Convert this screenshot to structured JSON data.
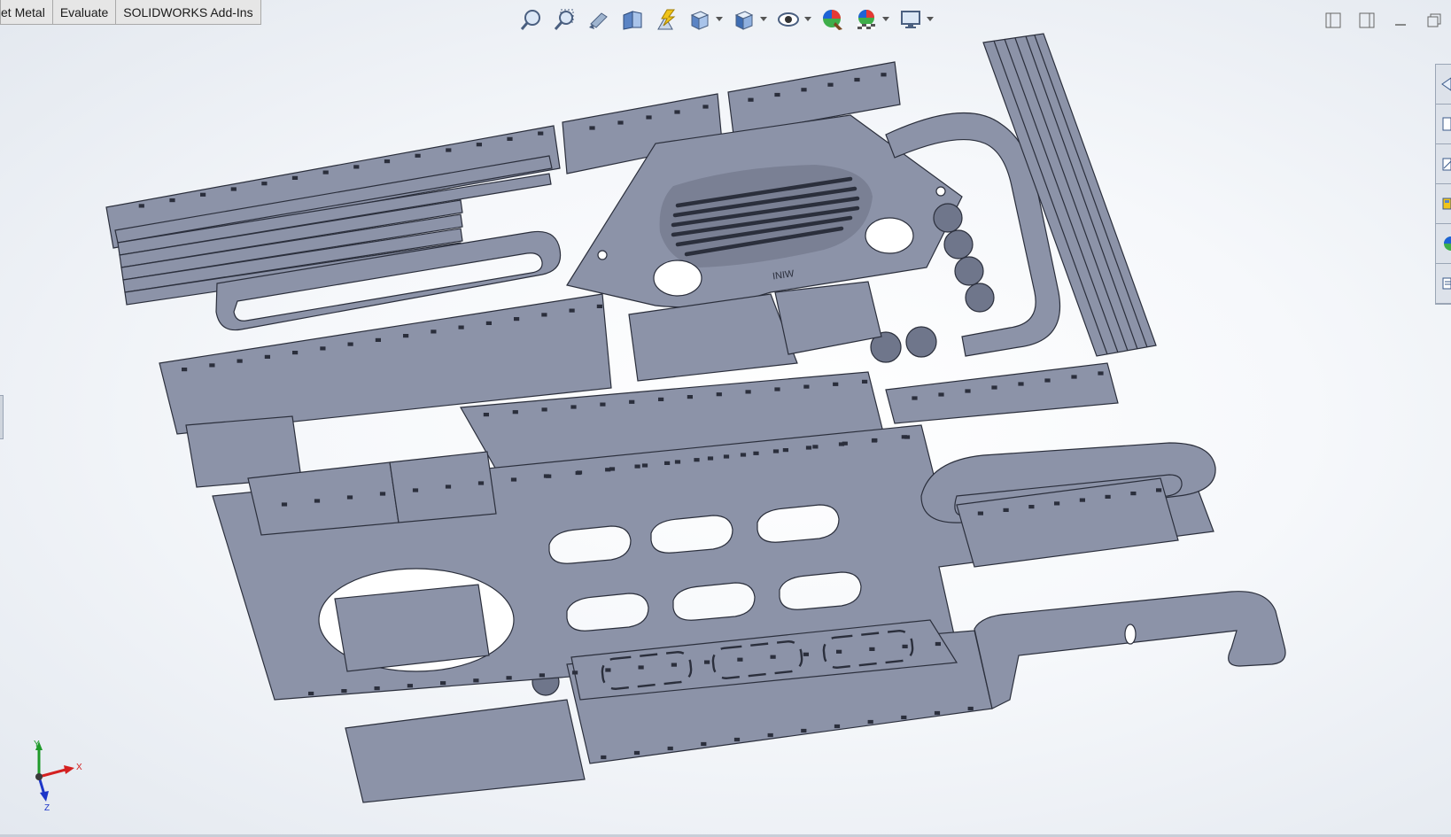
{
  "command_tabs": [
    {
      "label": "et Metal"
    },
    {
      "label": "Evaluate"
    },
    {
      "label": "SOLIDWORKS Add-Ins"
    }
  ],
  "heads_up_toolbar": [
    {
      "icon": "zoom-to-fit-icon"
    },
    {
      "icon": "zoom-to-area-icon"
    },
    {
      "icon": "previous-view-icon"
    },
    {
      "icon": "section-view-icon"
    },
    {
      "icon": "dynamic-annotation-views-icon"
    },
    {
      "icon": "view-orientation-icon",
      "dropdown": true
    },
    {
      "icon": "display-style-icon",
      "dropdown": true
    },
    {
      "icon": "hide-show-items-icon",
      "dropdown": true
    },
    {
      "icon": "edit-appearance-icon"
    },
    {
      "icon": "apply-scene-icon",
      "dropdown": true
    },
    {
      "icon": "view-settings-icon",
      "dropdown": true
    }
  ],
  "window_controls": [
    "tile-left-icon",
    "tile-right-icon",
    "minimize-icon",
    "restore-icon"
  ],
  "task_pane_tabs": [
    "solidworks-resources-icon",
    "design-library-icon",
    "file-explorer-icon",
    "view-palette-icon",
    "appearances-icon",
    "custom-properties-icon"
  ],
  "part_engraving": "INIW",
  "triad": {
    "x_label": "X",
    "y_label": "Y",
    "z_label": "Z"
  },
  "colors": {
    "part_face": "#8c93a8",
    "part_edge": "#2b2f3c",
    "part_side": "#5e6478",
    "background": "#f4f6f9",
    "triad_x": "#d42020",
    "triad_y": "#1f9a2a",
    "triad_z": "#1d36c8"
  }
}
